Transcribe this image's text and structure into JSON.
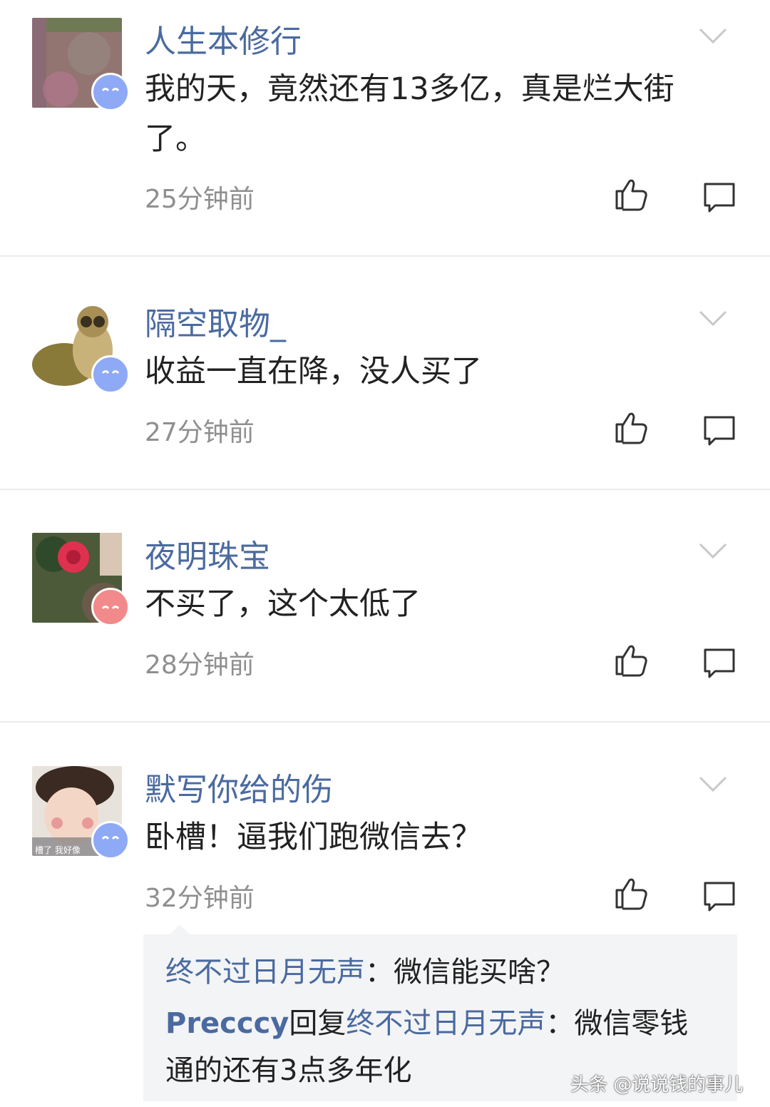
{
  "comments": [
    {
      "name": "人生本修行",
      "text": "我的天，竟然还有13多亿，真是烂大街了。",
      "time": "25分钟前"
    },
    {
      "name": "隔空取物_",
      "text": "收益一直在降，没人买了",
      "time": "27分钟前"
    },
    {
      "name": "夜明珠宝",
      "text": "不买了，这个太低了",
      "time": "28分钟前"
    },
    {
      "name": "默写你给的伤",
      "text": "卧槽！逼我们跑微信去？",
      "time": "32分钟前",
      "avatar_caption": "槽了 我好像"
    }
  ],
  "replies": {
    "r1": {
      "author": "终不过日月无声",
      "sep": "：",
      "text": "微信能买啥？"
    },
    "r2": {
      "author": "Precccy",
      "verb": "回复",
      "target": "终不过日月无声",
      "sep": "：",
      "text_a": "微信零钱",
      "text_b": "通的还有3点多年化"
    }
  },
  "watermark": "头条 @说说钱的事儿",
  "colors": {
    "name": "#4a6aa0",
    "badge_blue": "#8ea9f5",
    "badge_pink": "#f2898a",
    "time": "#8f8f8f"
  }
}
